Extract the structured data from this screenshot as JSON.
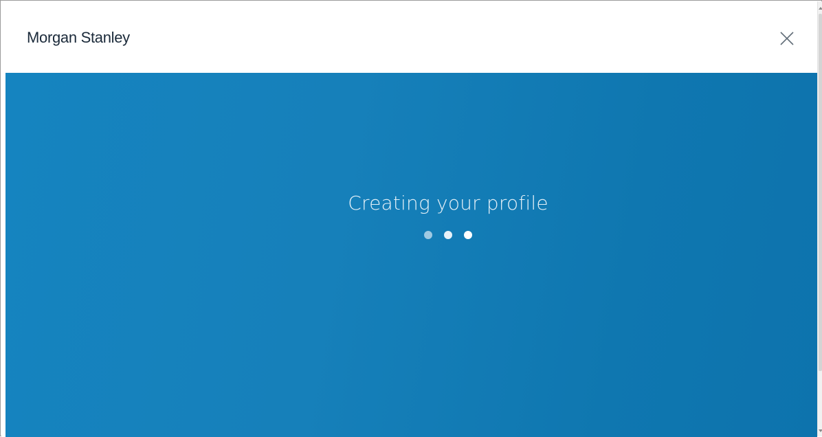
{
  "header": {
    "brand": "Morgan Stanley",
    "close_icon": "close-icon"
  },
  "main": {
    "status_text": "Creating your profile",
    "loading_indicator": {
      "dot_count": 3,
      "dot_colors": [
        "#9fc9e2",
        "#e7f1f8",
        "#ffffff"
      ]
    }
  },
  "colors": {
    "hero_background": "#1680ba",
    "brand_text": "#1b2a3a",
    "status_text": "#e6f1f8"
  }
}
